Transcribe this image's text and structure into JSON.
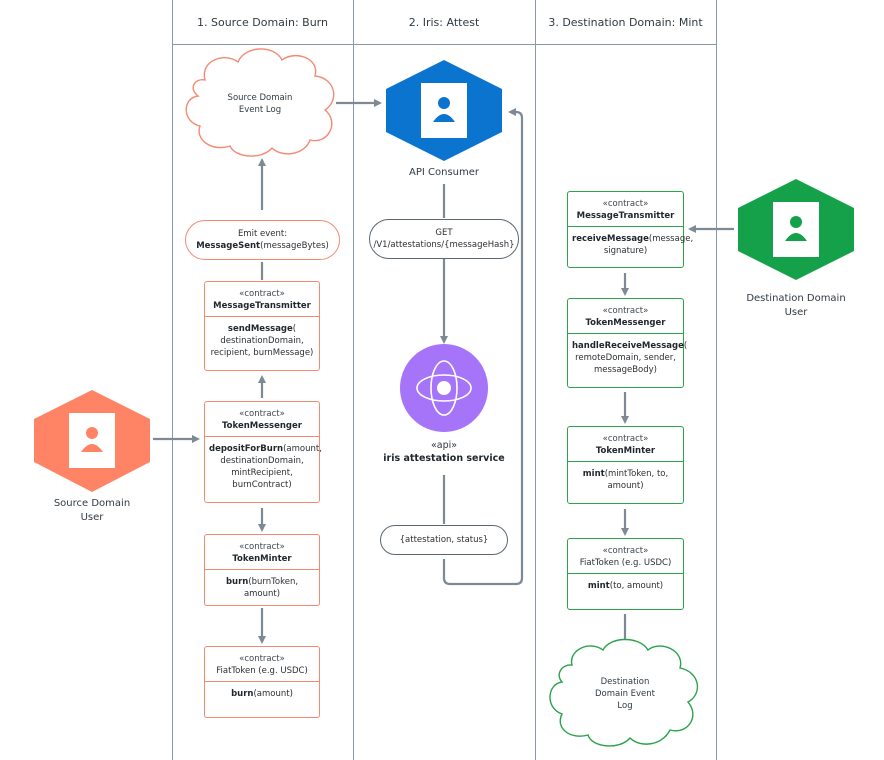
{
  "lanes": [
    {
      "label": "1.  Source Domain: Burn"
    },
    {
      "label": "2.  Iris: Attest"
    },
    {
      "label": "3.  Destination Domain: Mint"
    }
  ],
  "colors": {
    "source": "#f38a72",
    "iris": "#0a74cf",
    "service": "#a574f8",
    "destination": "#15a04a",
    "connector": "#7d8a96"
  },
  "source": {
    "event_log": {
      "line1": "Source Domain",
      "line2": "Event Log"
    },
    "emit_event": {
      "line1": "Emit event:",
      "method": "MessageSent",
      "args": "(messageBytes)"
    },
    "message_transmitter": {
      "stereotype": "«contract»",
      "name": "MessageTransmitter",
      "method": "sendMessage",
      "args": "( destinationDomain, recipient, burnMessage)"
    },
    "token_messenger": {
      "stereotype": "«contract»",
      "name": "TokenMessenger",
      "method": "depositForBurn",
      "args": "(amount, destinationDomain, mintRecipient, burnContract)"
    },
    "token_minter": {
      "stereotype": "«contract»",
      "name": "TokenMinter",
      "method": "burn",
      "args": "(burnToken, amount)"
    },
    "fiat_token": {
      "stereotype": "«contract»",
      "name": "FiatToken (e.g. USDC)",
      "method": "burn",
      "args": "(amount)"
    },
    "user": {
      "icon": "user-icon",
      "line1": "Source Domain",
      "line2": "User"
    }
  },
  "iris": {
    "api_consumer": {
      "icon": "user-icon",
      "label": "API Consumer"
    },
    "get_request": {
      "line1": "GET",
      "line2": "/V1/attestations/{messageHash}"
    },
    "service": {
      "icon": "atom-icon",
      "stereotype": "«api»",
      "name": "iris attestation service"
    },
    "response": {
      "label": "{attestation, status}"
    }
  },
  "destination": {
    "message_transmitter": {
      "stereotype": "«contract»",
      "name": "MessageTransmitter",
      "method": "receiveMessage",
      "args": "(message, signature)"
    },
    "token_messenger": {
      "stereotype": "«contract»",
      "name": "TokenMessenger",
      "method": "handleReceiveMessage",
      "args": "( remoteDomain, sender, messageBody)"
    },
    "token_minter": {
      "stereotype": "«contract»",
      "name": "TokenMinter",
      "method": "mint",
      "args": "(mintToken, to, amount)"
    },
    "fiat_token": {
      "stereotype": "«contract»",
      "name": "FiatToken (e.g. USDC)",
      "method": "mint",
      "args": "(to, amount)"
    },
    "event_log": {
      "line1": "Destination",
      "line2": "Domain Event",
      "line3": "Log"
    },
    "user": {
      "icon": "user-icon",
      "line1": "Destination Domain",
      "line2": "User"
    }
  }
}
